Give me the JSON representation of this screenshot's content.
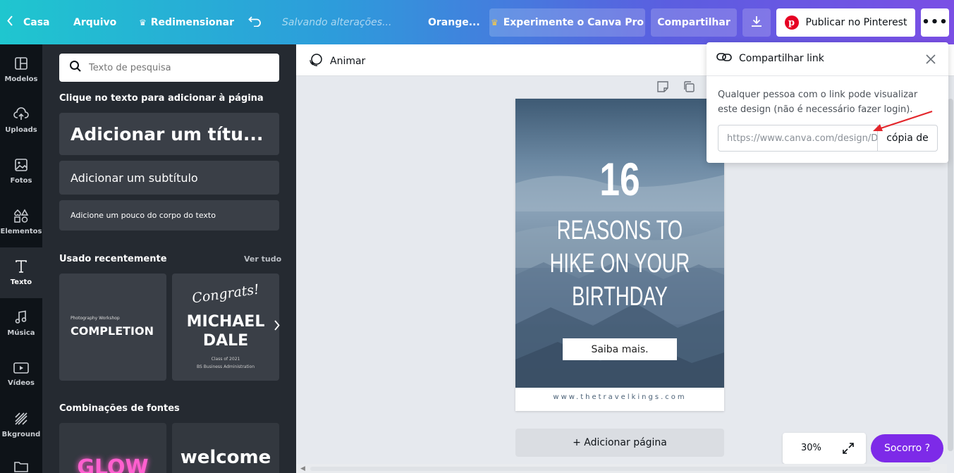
{
  "topbar": {
    "home": "Casa",
    "file": "Arquivo",
    "resize": "Redimensionar",
    "saving": "Salvando alterações...",
    "doc_title": "Orange...",
    "try_pro": "Experimente o Canva Pro",
    "share": "Compartilhar",
    "publish": "Publicar no Pinterest"
  },
  "rail": {
    "items": [
      {
        "label": "Modelos",
        "icon": "layout-icon"
      },
      {
        "label": "Uploads",
        "icon": "cloud-upload-icon"
      },
      {
        "label": "Fotos",
        "icon": "image-icon"
      },
      {
        "label": "Elementos",
        "icon": "shapes-icon"
      },
      {
        "label": "Texto",
        "icon": "text-icon"
      },
      {
        "label": "Música",
        "icon": "music-icon"
      },
      {
        "label": "Vídeos",
        "icon": "video-icon"
      },
      {
        "label": "Bkground",
        "icon": "background-icon"
      }
    ]
  },
  "panel": {
    "search_placeholder": "Texto de pesquisa",
    "click_hint": "Clique no texto para adicionar à página",
    "add_title": "Adicionar um títu...",
    "add_subtitle": "Adicionar um subtítulo",
    "add_body": "Adicione um pouco do corpo do texto",
    "recent_title": "Usado recentemente",
    "see_all": "Ver tudo",
    "thumb1": {
      "small": "Photography Workshop",
      "big": "COMPLETION"
    },
    "thumb2": {
      "script": "Congrats!",
      "name1": "MICHAEL",
      "name2": "DALE",
      "line1": "Class of 2021",
      "line2": "BS Business Administration"
    },
    "combos_title": "Combinações de fontes",
    "combo1": "GLOW",
    "combo2": "welcome"
  },
  "editor": {
    "animate": "Animar",
    "add_page": "+ Adicionar página",
    "zoom": "30%",
    "help": "Socorro ?"
  },
  "design": {
    "number": "16",
    "line1": "REASONS TO",
    "line2": "HIKE ON YOUR",
    "line3": "BIRTHDAY",
    "cta": "Saiba mais.",
    "footer": "www.thetravelkings.com"
  },
  "share_popup": {
    "title": "Compartilhar link",
    "description": "Qualquer pessoa com o link pode visualizar este design (não é necessário fazer login).",
    "link_value": "https://www.canva.com/design/D",
    "copy": "cópia de"
  },
  "colors": {
    "pinterest_red": "#e60023",
    "pro_crown": "#f7c948",
    "help_purple": "#7d2ae8",
    "panel_bg": "#252a31",
    "rail_bg": "#0e1318"
  }
}
